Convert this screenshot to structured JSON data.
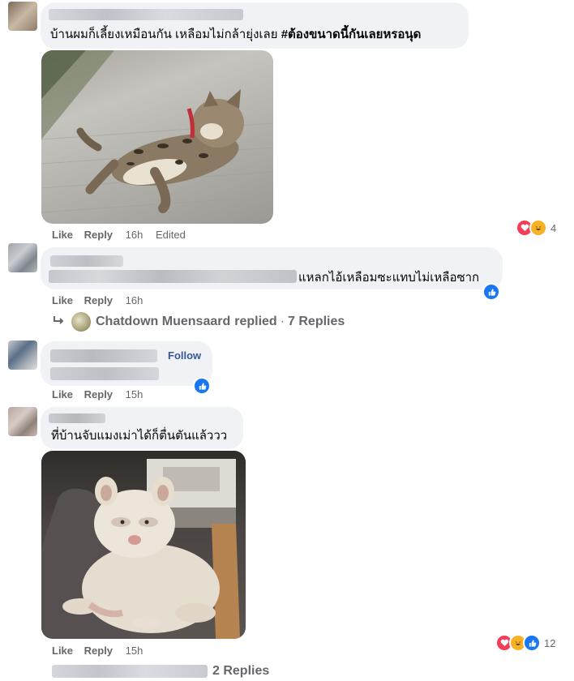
{
  "comments": [
    {
      "text_plain": "บ้านผมก็เลี้ยงเหมือนกัน เหลือมไม่กล้ายุ่งเลย ",
      "text_hashtag": "#ต้องขนาดนี้กันเลยหรอนุด",
      "actions": {
        "like": "Like",
        "reply": "Reply",
        "time": "16h",
        "edited": "Edited"
      },
      "reactions": {
        "count": "4",
        "icons": [
          "love-reaction",
          "haha-reaction"
        ]
      }
    },
    {
      "text": "แหลกไอ้เหลือมซะแทบไม่เหลือซาก",
      "actions": {
        "like": "Like",
        "reply": "Reply",
        "time": "16h"
      },
      "reactions": {
        "icons": [
          "like-reaction"
        ]
      },
      "reply_thread": {
        "author": "Chatdown Muensaard",
        "action": "replied",
        "sep": "·",
        "count": "7 Replies"
      }
    },
    {
      "follow": "Follow",
      "actions": {
        "like": "Like",
        "reply": "Reply",
        "time": "15h"
      },
      "reactions": {
        "icons": [
          "like-reaction"
        ]
      }
    },
    {
      "text": "ที่บ้านจับแมงเม่าได้ก็ตื่นตันแล้ววว",
      "actions": {
        "like": "Like",
        "reply": "Reply",
        "time": "15h"
      },
      "reactions": {
        "count": "12",
        "icons": [
          "love-reaction",
          "haha-reaction",
          "like-reaction"
        ]
      },
      "replies": "2 Replies"
    }
  ],
  "colors": {
    "like_blue": "#1877f2",
    "love_red": "#f33e58",
    "haha_yellow": "#f7b125",
    "link": "#385898",
    "meta_gray": "#65676b",
    "bubble_bg": "#f0f2f5"
  }
}
